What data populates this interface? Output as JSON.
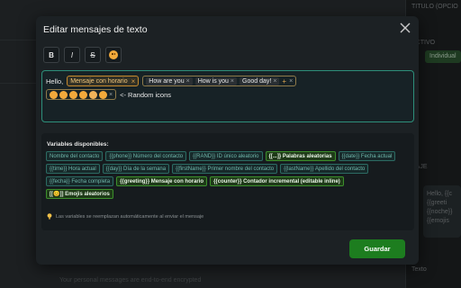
{
  "modal": {
    "title": "Editar mensajes de texto",
    "save_label": "Guardar"
  },
  "toolbar": {
    "bold": "B",
    "italic": "I",
    "strike": "S",
    "emoji_icon": "smiley-face-icon"
  },
  "editor": {
    "hello": "Hello,",
    "variable_chip": "Mensaje con horario",
    "random_options": [
      "How are you",
      "How is you",
      "Good day!"
    ],
    "random_label": "<- Random icons"
  },
  "variables": {
    "title": "Variables disponibles:",
    "items": [
      {
        "label": "Nombre del contacto",
        "active": false
      },
      {
        "label": "{{phone}} Número del contacto",
        "active": false
      },
      {
        "label": "{{RAND}} ID único aleatorio",
        "active": false
      },
      {
        "label": "{[...]} Palabras aleatorias",
        "active": true
      },
      {
        "label": "{{date}} Fecha actual",
        "active": false
      },
      {
        "label": "{{time}} Hora actual",
        "active": false
      },
      {
        "label": "{{day}} Día de la semana",
        "active": false
      },
      {
        "label": "{{firstName}} Primer nombre del contacto",
        "active": false
      },
      {
        "label": "{{lastName}} Apellido del contacto",
        "active": false
      },
      {
        "label": "{{fecha}} Fecha completa",
        "active": false
      },
      {
        "label": "{{greeting}} Mensaje con horario",
        "active": true
      },
      {
        "label": "{{counter}} Contador incremental (editable inline)",
        "active": true
      },
      {
        "label": "[[😊]] Emojis aleatorios",
        "active": true
      }
    ],
    "hint": "Las variables se reemplazan automáticamente al enviar el mensaje"
  },
  "background": {
    "right_title": "TITULO (OPCIO",
    "right_active": "ACTIVO",
    "right_individual": "Individual",
    "right_section": "SAJE",
    "bubble_lines": [
      "Hello, {{c",
      "{{greeti",
      "{{noche}}",
      "{{emojis"
    ],
    "right_footer": "Texto",
    "bottom_text": "Your personal messages are end-to-end encrypted"
  },
  "colors": {
    "accent_teal": "#2d8f7a",
    "accent_green": "#1d7d1f",
    "accent_orange": "#c68a2e"
  }
}
